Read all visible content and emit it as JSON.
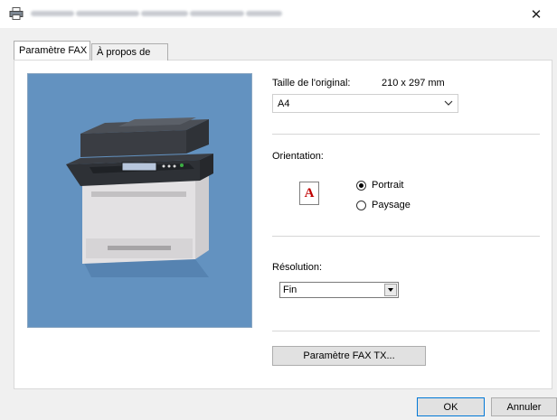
{
  "window": {
    "close_glyph": "✕"
  },
  "tabs": [
    {
      "label": "Paramètre FAX",
      "active": true
    },
    {
      "label": "À propos de",
      "active": false
    }
  ],
  "original_size": {
    "label": "Taille de l'original:",
    "value": "210 x 297 mm",
    "selected": "A4"
  },
  "orientation": {
    "label": "Orientation:",
    "icon_letter": "A",
    "options": [
      {
        "label": "Portrait",
        "checked": true
      },
      {
        "label": "Paysage",
        "checked": false
      }
    ]
  },
  "resolution": {
    "label": "Résolution:",
    "selected": "Fin"
  },
  "buttons": {
    "fax_tx": "Paramètre FAX TX...",
    "ok": "OK",
    "cancel": "Annuler"
  },
  "colors": {
    "preview_background": "#6392c0",
    "accent": "#0078d7",
    "orientation_letter": "#c00000"
  },
  "icons": {
    "title": "printer-icon",
    "combo": "chevron-down-icon"
  }
}
